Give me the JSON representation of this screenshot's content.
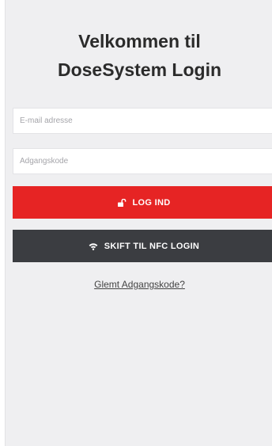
{
  "header": {
    "title_line1": "Velkommen til",
    "title_line2": "DoseSystem Login"
  },
  "form": {
    "email_placeholder": "E-mail adresse",
    "email_value": "",
    "password_placeholder": "Adgangskode",
    "password_value": "",
    "login_label": "LOG IND",
    "login_icon": "unlock-icon",
    "nfc_label": "SKIFT TIL NFC LOGIN",
    "nfc_icon": "wifi-icon",
    "forgot_label": "Glemt Adgangskode?"
  },
  "colors": {
    "login_button": "#e62424",
    "nfc_button": "#3b3d41",
    "background": "#efeff1"
  }
}
